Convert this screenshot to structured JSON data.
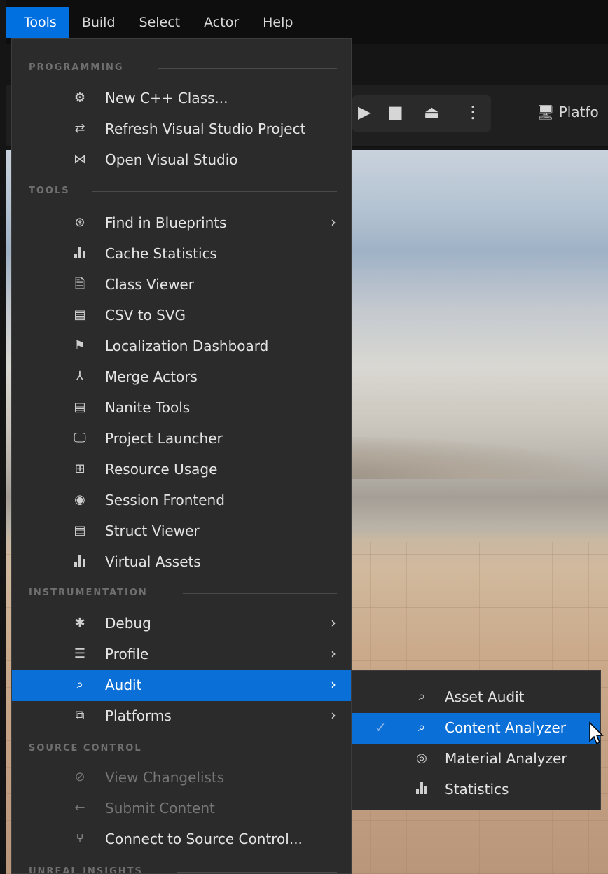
{
  "menubar": {
    "items": [
      "Tools",
      "Build",
      "Select",
      "Actor",
      "Help"
    ]
  },
  "toolbar": {
    "platform_label": "Platfo"
  },
  "menu": {
    "sections": {
      "programming": "PROGRAMMING",
      "tools": "TOOLS",
      "instrumentation": "INSTRUMENTATION",
      "source_control": "SOURCE CONTROL",
      "unreal_insights": "UNREAL INSIGHTS"
    },
    "items": {
      "new_cpp_class": "New C++ Class...",
      "refresh_vs": "Refresh Visual Studio Project",
      "open_vs": "Open Visual Studio",
      "find_in_blueprints": "Find in Blueprints",
      "cache_statistics": "Cache Statistics",
      "class_viewer": "Class Viewer",
      "csv_to_svg": "CSV to SVG",
      "localization_dashboard": "Localization Dashboard",
      "merge_actors": "Merge Actors",
      "nanite_tools": "Nanite Tools",
      "project_launcher": "Project Launcher",
      "resource_usage": "Resource Usage",
      "session_frontend": "Session Frontend",
      "struct_viewer": "Struct Viewer",
      "virtual_assets": "Virtual Assets",
      "debug": "Debug",
      "profile": "Profile",
      "audit": "Audit",
      "platforms": "Platforms",
      "view_changelists": "View Changelists",
      "submit_content": "Submit Content",
      "connect_source_control": "Connect to Source Control..."
    }
  },
  "submenu": {
    "asset_audit": "Asset Audit",
    "content_analyzer": "Content Analyzer",
    "material_analyzer": "Material Analyzer",
    "statistics": "Statistics"
  },
  "colors": {
    "accent": "#0a6fd6",
    "menu_bg": "#2b2b2b"
  }
}
